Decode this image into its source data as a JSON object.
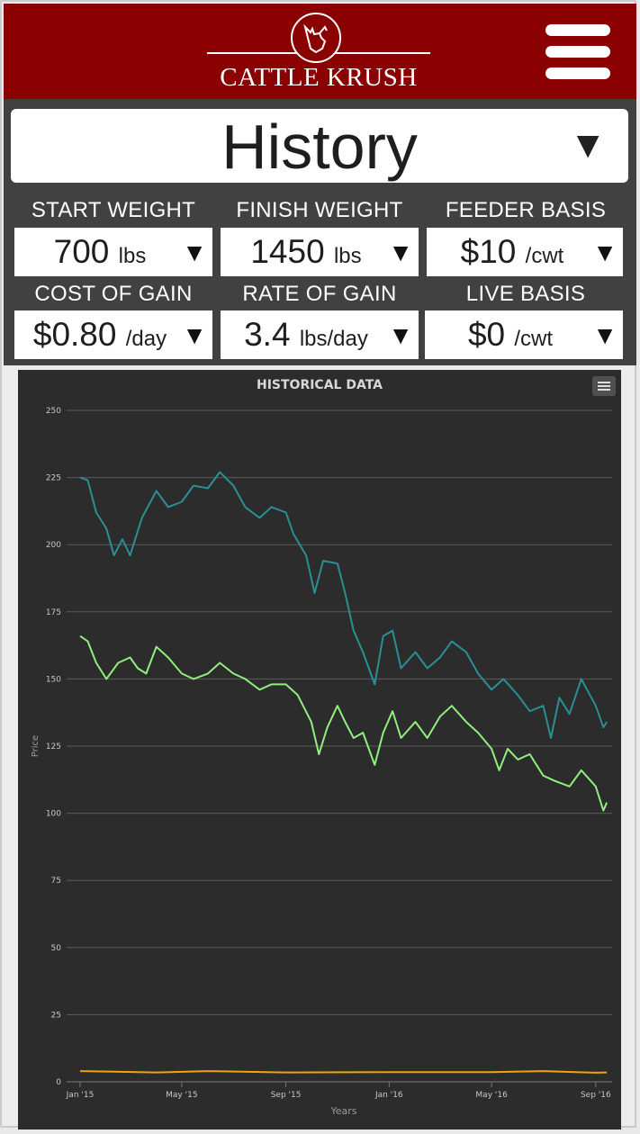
{
  "header": {
    "brand": "CATTLE KRUSH",
    "logo_icon": "bull-head-icon",
    "menu_icon": "hamburger-menu-icon"
  },
  "view_select": {
    "value": "History",
    "arrow": "▼"
  },
  "fields": [
    {
      "label": "START WEIGHT",
      "value": "700",
      "unit": "lbs",
      "arrow": "▼"
    },
    {
      "label": "FINISH WEIGHT",
      "value": "1450",
      "unit": "lbs",
      "arrow": "▼"
    },
    {
      "label": "FEEDER BASIS",
      "value": "$10",
      "unit": "/cwt",
      "arrow": "▼"
    },
    {
      "label": "COST OF GAIN",
      "value": "$0.80",
      "unit": "/day",
      "arrow": "▼"
    },
    {
      "label": "RATE OF GAIN",
      "value": "3.4",
      "unit": "lbs/day",
      "arrow": "▼"
    },
    {
      "label": "LIVE BASIS",
      "value": "$0",
      "unit": "/cwt",
      "arrow": "▼"
    }
  ],
  "colors": {
    "header_bg": "#8b0000",
    "controls_bg": "#414141",
    "chart_bg": "#2c2c2c",
    "series_teal": "#2a8f93",
    "series_green": "#90ee7e",
    "series_orange": "#f0a30a"
  },
  "chart_data": {
    "type": "line",
    "title": "HISTORICAL DATA",
    "xlabel": "Years",
    "ylabel": "Price",
    "ylim": [
      0,
      250
    ],
    "yticks": [
      0,
      25,
      50,
      75,
      100,
      125,
      150,
      175,
      200,
      225,
      250
    ],
    "xlim": [
      "2015-01-01",
      "2016-09-15"
    ],
    "xticks": [
      {
        "date": "2015-01-01",
        "label": "Jan '15"
      },
      {
        "date": "2015-05-01",
        "label": "May '15"
      },
      {
        "date": "2015-09-01",
        "label": "Sep '15"
      },
      {
        "date": "2016-01-01",
        "label": "Jan '16"
      },
      {
        "date": "2016-05-01",
        "label": "May '16"
      },
      {
        "date": "2016-09-01",
        "label": "Sep '16"
      }
    ],
    "grid": true,
    "series": [
      {
        "color": "#2a8f93",
        "points": [
          [
            "2015-01-01",
            225
          ],
          [
            "2015-01-10",
            224
          ],
          [
            "2015-01-20",
            212
          ],
          [
            "2015-02-01",
            206
          ],
          [
            "2015-02-10",
            196
          ],
          [
            "2015-02-20",
            202
          ],
          [
            "2015-03-01",
            196
          ],
          [
            "2015-03-15",
            210
          ],
          [
            "2015-04-01",
            220
          ],
          [
            "2015-04-15",
            214
          ],
          [
            "2015-05-01",
            216
          ],
          [
            "2015-05-15",
            222
          ],
          [
            "2015-06-01",
            221
          ],
          [
            "2015-06-15",
            227
          ],
          [
            "2015-07-01",
            222
          ],
          [
            "2015-07-15",
            214
          ],
          [
            "2015-08-01",
            210
          ],
          [
            "2015-08-15",
            214
          ],
          [
            "2015-09-01",
            212
          ],
          [
            "2015-09-10",
            204
          ],
          [
            "2015-09-25",
            196
          ],
          [
            "2015-10-05",
            182
          ],
          [
            "2015-10-15",
            194
          ],
          [
            "2015-11-01",
            193
          ],
          [
            "2015-11-10",
            182
          ],
          [
            "2015-11-20",
            168
          ],
          [
            "2015-12-01",
            160
          ],
          [
            "2015-12-15",
            148
          ],
          [
            "2015-12-25",
            166
          ],
          [
            "2016-01-05",
            168
          ],
          [
            "2016-01-15",
            154
          ],
          [
            "2016-02-01",
            160
          ],
          [
            "2016-02-15",
            154
          ],
          [
            "2016-03-01",
            158
          ],
          [
            "2016-03-15",
            164
          ],
          [
            "2016-04-01",
            160
          ],
          [
            "2016-04-15",
            152
          ],
          [
            "2016-05-01",
            146
          ],
          [
            "2016-05-15",
            150
          ],
          [
            "2016-06-01",
            144
          ],
          [
            "2016-06-15",
            138
          ],
          [
            "2016-07-01",
            140
          ],
          [
            "2016-07-10",
            128
          ],
          [
            "2016-07-20",
            143
          ],
          [
            "2016-08-01",
            137
          ],
          [
            "2016-08-15",
            150
          ],
          [
            "2016-09-01",
            140
          ],
          [
            "2016-09-10",
            132
          ],
          [
            "2016-09-14",
            134
          ]
        ]
      },
      {
        "color": "#90ee7e",
        "points": [
          [
            "2015-01-01",
            166
          ],
          [
            "2015-01-10",
            164
          ],
          [
            "2015-01-20",
            156
          ],
          [
            "2015-02-01",
            150
          ],
          [
            "2015-02-15",
            156
          ],
          [
            "2015-03-01",
            158
          ],
          [
            "2015-03-10",
            154
          ],
          [
            "2015-03-20",
            152
          ],
          [
            "2015-04-01",
            162
          ],
          [
            "2015-04-15",
            158
          ],
          [
            "2015-05-01",
            152
          ],
          [
            "2015-05-15",
            150
          ],
          [
            "2015-06-01",
            152
          ],
          [
            "2015-06-15",
            156
          ],
          [
            "2015-07-01",
            152
          ],
          [
            "2015-07-15",
            150
          ],
          [
            "2015-08-01",
            146
          ],
          [
            "2015-08-15",
            148
          ],
          [
            "2015-09-01",
            148
          ],
          [
            "2015-09-15",
            144
          ],
          [
            "2015-10-01",
            134
          ],
          [
            "2015-10-10",
            122
          ],
          [
            "2015-10-20",
            132
          ],
          [
            "2015-11-01",
            140
          ],
          [
            "2015-11-10",
            134
          ],
          [
            "2015-11-20",
            128
          ],
          [
            "2015-12-01",
            130
          ],
          [
            "2015-12-15",
            118
          ],
          [
            "2015-12-25",
            130
          ],
          [
            "2016-01-05",
            138
          ],
          [
            "2016-01-15",
            128
          ],
          [
            "2016-02-01",
            134
          ],
          [
            "2016-02-15",
            128
          ],
          [
            "2016-03-01",
            136
          ],
          [
            "2016-03-15",
            140
          ],
          [
            "2016-04-01",
            134
          ],
          [
            "2016-04-15",
            130
          ],
          [
            "2016-05-01",
            124
          ],
          [
            "2016-05-10",
            116
          ],
          [
            "2016-05-20",
            124
          ],
          [
            "2016-06-01",
            120
          ],
          [
            "2016-06-15",
            122
          ],
          [
            "2016-07-01",
            114
          ],
          [
            "2016-07-15",
            112
          ],
          [
            "2016-08-01",
            110
          ],
          [
            "2016-08-15",
            116
          ],
          [
            "2016-09-01",
            110
          ],
          [
            "2016-09-10",
            101
          ],
          [
            "2016-09-14",
            104
          ]
        ]
      },
      {
        "color": "#f0a30a",
        "points": [
          [
            "2015-01-01",
            4
          ],
          [
            "2015-04-01",
            3.5
          ],
          [
            "2015-06-01",
            4
          ],
          [
            "2015-09-01",
            3.5
          ],
          [
            "2016-01-01",
            3.6
          ],
          [
            "2016-05-01",
            3.6
          ],
          [
            "2016-07-01",
            4
          ],
          [
            "2016-09-01",
            3.4
          ],
          [
            "2016-09-14",
            3.5
          ]
        ]
      }
    ]
  }
}
